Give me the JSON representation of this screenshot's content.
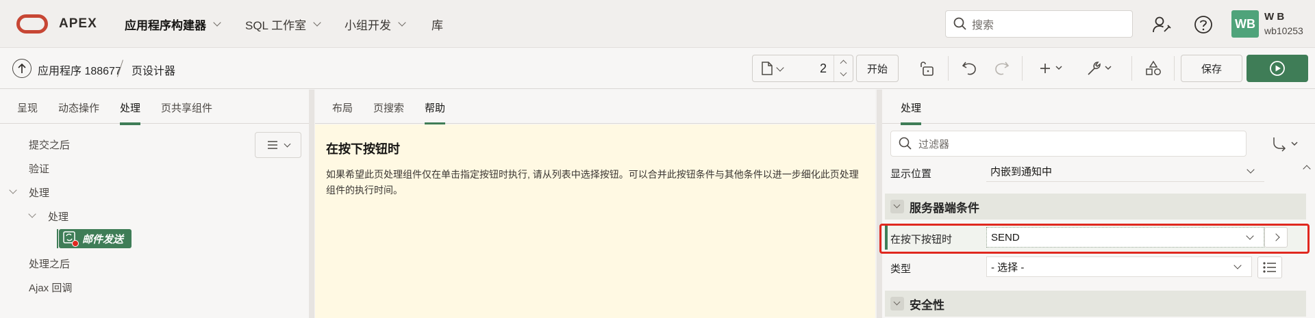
{
  "header": {
    "brand": "APEX",
    "nav": [
      {
        "label": "应用程序构建器",
        "has_menu": true,
        "active": true
      },
      {
        "label": "SQL 工作室",
        "has_menu": true
      },
      {
        "label": "小组开发",
        "has_menu": true
      },
      {
        "label": "库",
        "has_menu": false
      }
    ],
    "search_placeholder": "搜索",
    "user": {
      "initials": "WB",
      "name": "W B",
      "id": "wb10253"
    }
  },
  "toolbar": {
    "app_crumb": "应用程序 188677",
    "page_crumb": "页设计器",
    "page_number": "2",
    "go_label": "开始",
    "save_label": "保存"
  },
  "left_panel": {
    "tabs": [
      "呈现",
      "动态操作",
      "处理",
      "页共享组件"
    ],
    "active_tab": "处理",
    "tree": {
      "after_submit": "提交之后",
      "validation": "验证",
      "processing": "处理",
      "processing_child": "处理",
      "node": "邮件发送",
      "after_processing": "处理之后",
      "ajax_callback": "Ajax 回调"
    }
  },
  "mid_panel": {
    "tabs": [
      "布局",
      "页搜索",
      "帮助"
    ],
    "active_tab": "帮助",
    "help_title": "在按下按钮时",
    "help_text": "如果希望此页处理组件仅在单击指定按钮时执行, 请从列表中选择按钮。可以合并此按钮条件与其他条件以进一步细化此页处理组件的执行时间。"
  },
  "right_panel": {
    "tab": "处理",
    "filter_placeholder": "过滤器",
    "display_location_label": "显示位置",
    "display_location_value": "内嵌到通知中",
    "server_condition_group": "服务器端条件",
    "when_button_label": "在按下按钮时",
    "when_button_value": "SEND",
    "type_label": "类型",
    "type_value": "- 选择 -",
    "security_group": "安全性"
  },
  "colors": {
    "brand_red": "#c74634",
    "accent_green": "#3f7d57",
    "highlight_red": "#e0281f",
    "help_bg": "#fff9e3"
  }
}
